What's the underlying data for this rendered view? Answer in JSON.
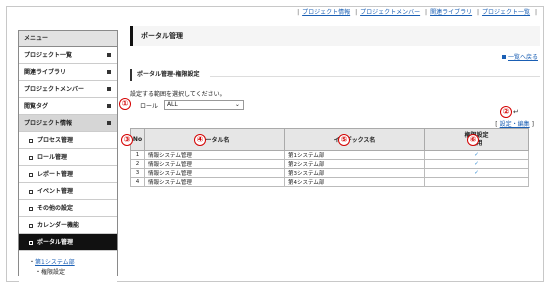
{
  "topnav": {
    "links": [
      "プロジェクト情報",
      "プロジェクトメンバー",
      "関連ライブラリ",
      "プロジェクト一覧"
    ]
  },
  "sidebar": {
    "title": "メニュー",
    "items": [
      {
        "label": "プロジェクト一覧"
      },
      {
        "label": "関連ライブラリ"
      },
      {
        "label": "プロジェクトメンバー"
      },
      {
        "label": "閲覧タグ"
      },
      {
        "label": "プロジェクト情報"
      }
    ],
    "subitems": [
      {
        "label": "プロセス管理"
      },
      {
        "label": "ロール管理"
      },
      {
        "label": "レポート管理"
      },
      {
        "label": "イベント管理"
      },
      {
        "label": "その他の設定"
      },
      {
        "label": "カレンダー機能"
      },
      {
        "label": "ポータル管理"
      }
    ],
    "tree": {
      "link": "第1システム部",
      "child": "・権限設定"
    }
  },
  "main": {
    "title": "ポータル管理",
    "back_link": "一覧へ戻る",
    "section_title": "ポータル管理-権限設定",
    "instruction": "設定する範囲を選択してください。",
    "role_label": "ロール",
    "role_value": "ALL",
    "settings_link": "設定・編集",
    "table": {
      "headers": {
        "no": "No",
        "portal": "ポータル名",
        "index": "インデックス名",
        "perm_top": "権限設定",
        "perm_bottom": "利用"
      },
      "rows": [
        {
          "no": "1",
          "portal": "情報システム管理",
          "index": "第1システム部",
          "use": "✓"
        },
        {
          "no": "2",
          "portal": "情報システム管理",
          "index": "第2システム部",
          "use": "✓"
        },
        {
          "no": "3",
          "portal": "情報システム管理",
          "index": "第3システム部",
          "use": "✓"
        },
        {
          "no": "4",
          "portal": "情報システム管理",
          "index": "第4システム部",
          "use": ""
        }
      ]
    }
  },
  "callouts": [
    "①",
    "②",
    "③",
    "④",
    "⑤",
    "⑥"
  ],
  "colors": {
    "callout": "#d40000",
    "link": "#1a5fb4",
    "check": "#2a85d0",
    "current_item_bg": "#111111"
  }
}
